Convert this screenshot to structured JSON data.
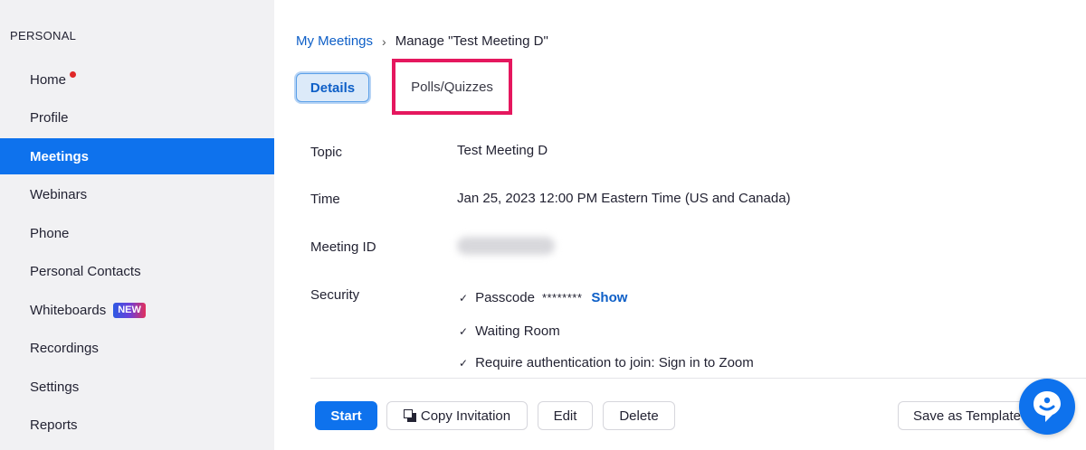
{
  "sidebar": {
    "heading": "PERSONAL",
    "items": [
      {
        "label": "Home",
        "has_dot": true
      },
      {
        "label": "Profile"
      },
      {
        "label": "Meetings",
        "active": true
      },
      {
        "label": "Webinars"
      },
      {
        "label": "Phone"
      },
      {
        "label": "Personal Contacts"
      },
      {
        "label": "Whiteboards",
        "badge": "NEW"
      },
      {
        "label": "Recordings"
      },
      {
        "label": "Settings"
      },
      {
        "label": "Reports"
      }
    ]
  },
  "breadcrumb": {
    "parent": "My Meetings",
    "separator": "›",
    "current": "Manage \"Test Meeting D\""
  },
  "tabs": {
    "details": "Details",
    "polls": "Polls/Quizzes"
  },
  "details": {
    "topic_label": "Topic",
    "topic_value": "Test Meeting D",
    "time_label": "Time",
    "time_value": "Jan 25, 2023 12:00 PM Eastern Time (US and Canada)",
    "meeting_id_label": "Meeting ID",
    "security_label": "Security",
    "security": {
      "passcode_label": "Passcode",
      "passcode_mask": "********",
      "show_link": "Show",
      "waiting_room": "Waiting Room",
      "auth": "Require authentication to join: Sign in to Zoom"
    }
  },
  "actions": {
    "start": "Start",
    "copy_invitation": "Copy Invitation",
    "edit": "Edit",
    "delete": "Delete",
    "save_template": "Save as Template"
  },
  "colors": {
    "accent": "#0e72ed",
    "highlight_box": "#e5175e"
  },
  "icons": {
    "check": "checkmark-icon",
    "copy": "copy-icon",
    "chat": "chat-bubble-icon"
  }
}
